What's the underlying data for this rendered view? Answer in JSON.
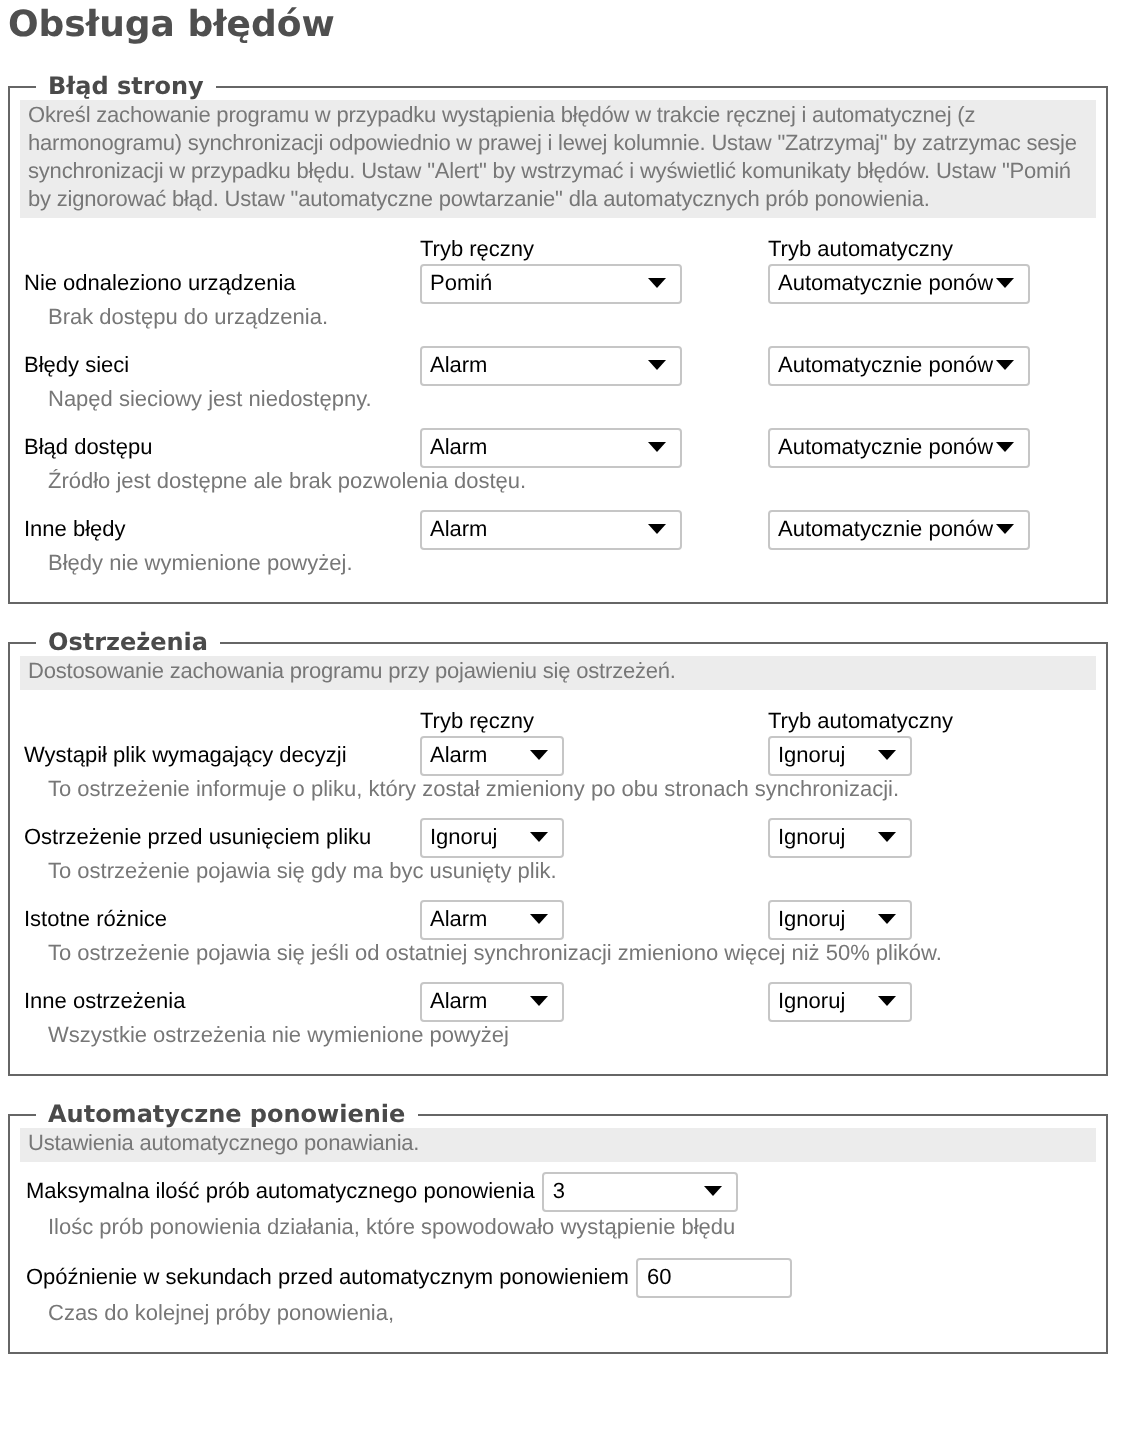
{
  "title": "Obsługa błędów",
  "sections": [
    {
      "kind": "errors",
      "legend": "Błąd strony",
      "description": "Określ zachowanie programu w przypadku wystąpienia błędów w trakcie ręcznej i automatycznej (z harmonogramu) synchronizacji odpowiednio w prawej i lewej kolumnie. Ustaw \"Zatrzymaj\" by zatrzymac sesje synchronizacji w przypadku błędu. Ustaw \"Alert\" by wstrzymać i wyświetlić komunikaty błędów. Ustaw \"Pomiń by zignorować błąd. Ustaw \"automatyczne powtarzanie\" dla automatycznych prób ponowienia.",
      "column_headers": [
        "Tryb ręczny",
        "Tryb automatyczny"
      ],
      "rows": [
        {
          "label": "Nie odnaleziono urządzenia",
          "hint": "Brak dostępu do urządzenia.",
          "manual": "Pomiń",
          "automatic": "Automatycznie ponów"
        },
        {
          "label": "Błędy sieci",
          "hint": "Napęd sieciowy jest niedostępny.",
          "manual": "Alarm",
          "automatic": "Automatycznie ponów"
        },
        {
          "label": "Błąd dostępu",
          "hint": "Źródło jest dostępne ale brak pozwolenia dostęu.",
          "manual": "Alarm",
          "automatic": "Automatycznie ponów"
        },
        {
          "label": "Inne błędy",
          "hint": "Błędy nie wymienione powyżej.",
          "manual": "Alarm",
          "automatic": "Automatycznie ponów"
        }
      ]
    },
    {
      "kind": "warnings",
      "legend": "Ostrzeżenia",
      "description": "Dostosowanie zachowania programu przy pojawieniu się ostrzeżeń.",
      "column_headers": [
        "Tryb ręczny",
        "Tryb automatyczny"
      ],
      "rows": [
        {
          "label": "Wystąpił plik wymagający decyzji",
          "hint": "To ostrzeżenie informuje o pliku, który został zmieniony po obu stronach synchronizacji.",
          "manual": "Alarm",
          "automatic": "Ignoruj"
        },
        {
          "label": "Ostrzeżenie przed usunięciem pliku",
          "hint": "To ostrzeżenie pojawia się gdy ma byc usunięty plik.",
          "manual": "Ignoruj",
          "automatic": "Ignoruj"
        },
        {
          "label": "Istotne różnice",
          "hint": "To ostrzeżenie pojawia się jeśli od ostatniej synchronizacji zmieniono więcej niż 50% plików.",
          "manual": "Alarm",
          "automatic": "Ignoruj"
        },
        {
          "label": "Inne ostrzeżenia",
          "hint": "Wszystkie ostrzeżenia nie wymienione powyżej",
          "manual": "Alarm",
          "automatic": "Ignoruj"
        }
      ]
    },
    {
      "kind": "retry",
      "legend": "Automatyczne ponowienie",
      "description": "Ustawienia automatycznego ponawiania.",
      "rows": [
        {
          "kind": "dropdown",
          "label": "Maksymalna ilość prób automatycznego ponowienia",
          "value": "3",
          "hint": "Ilośc prób ponowienia działania, które spowodowało wystąpienie błędu"
        },
        {
          "kind": "text-input",
          "label": "Opóźnienie w sekundach przed automatycznym ponowieniem",
          "value": "60",
          "hint": "Czas do kolejnej próby ponowienia,"
        }
      ]
    }
  ]
}
